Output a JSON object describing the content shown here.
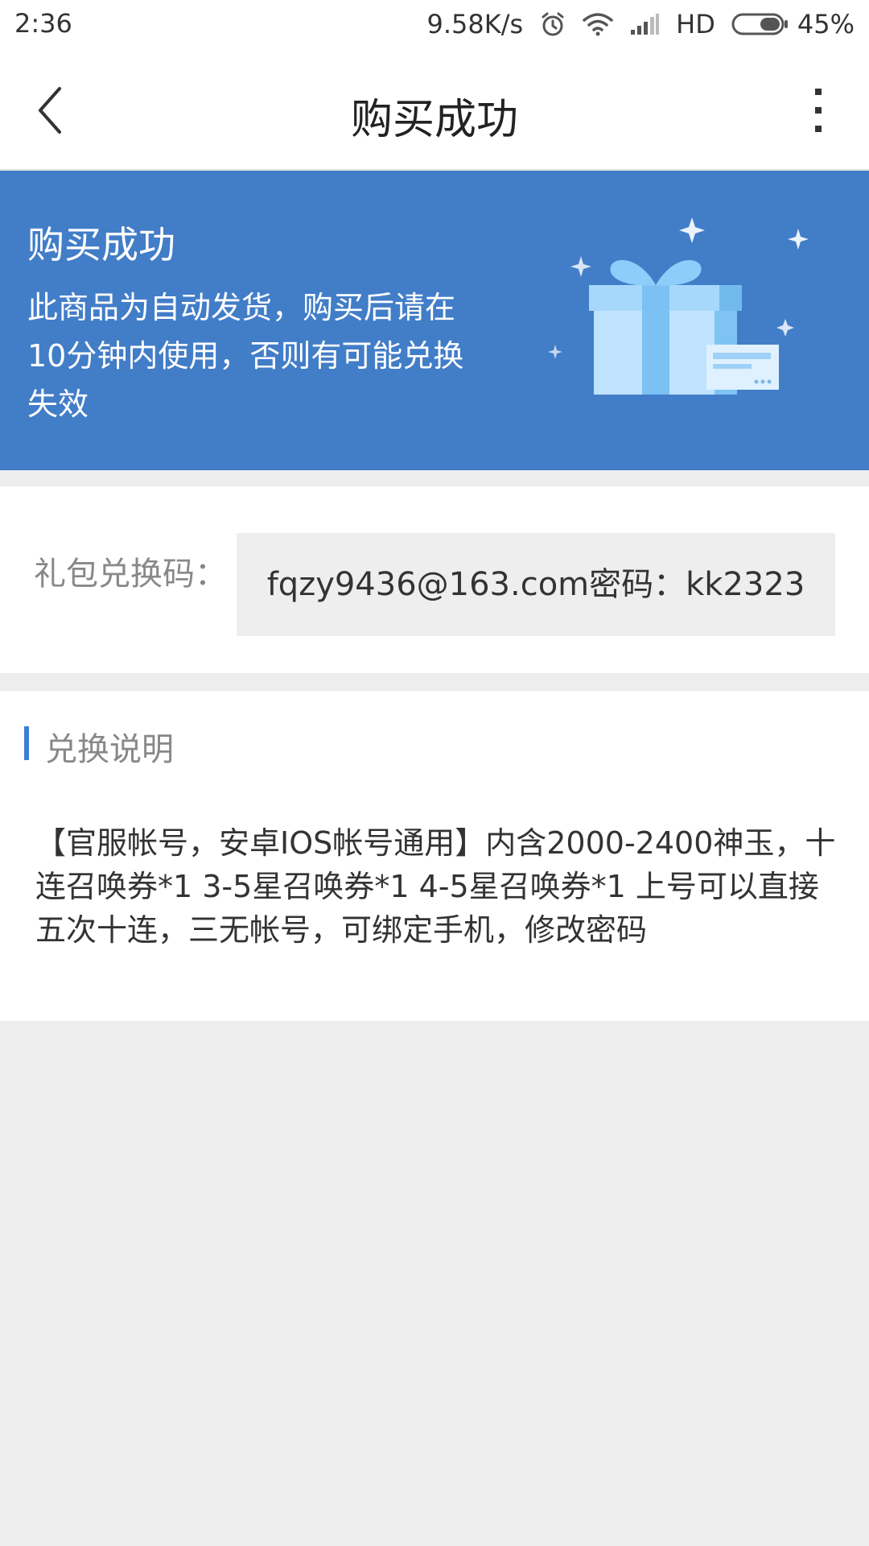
{
  "status_bar": {
    "time": "2:36",
    "net_speed": "9.58K/s",
    "network_type": "HD",
    "battery": "45%",
    "battery_level": 0.45
  },
  "nav": {
    "title": "购买成功"
  },
  "banner": {
    "title": "购买成功",
    "description": "此商品为自动发货，购买后请在10分钟内使用，否则有可能兑换失效",
    "background_color": "#427dc8"
  },
  "gift_code": {
    "label": "礼包兑换码：",
    "value": "fqzy9436@163.com密码：kk2323"
  },
  "instructions": {
    "heading": "兑换说明",
    "content": "【官服帐号，安卓IOS帐号通用】内含2000-2400神玉，十连召唤券*1 3-5星召唤券*1 4-5星召唤券*1 上号可以直接五次十连，三无帐号，可绑定手机，修改密码",
    "accent_color": "#3d7fd6"
  },
  "icons": [
    "back-arrow-icon",
    "more-vertical-icon",
    "alarm-icon",
    "wifi-icon",
    "signal-icon",
    "battery-icon",
    "gift-box-illustration"
  ]
}
